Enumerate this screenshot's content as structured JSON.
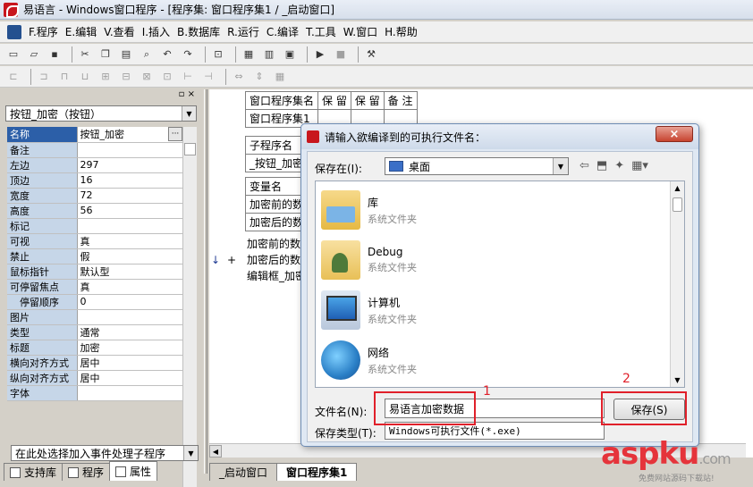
{
  "window": {
    "title": "易语言 - Windows窗口程序 - [程序集: 窗口程序集1 / _启动窗口]"
  },
  "menu": [
    "F.程序",
    "E.编辑",
    "V.查看",
    "I.插入",
    "B.数据库",
    "R.运行",
    "C.编译",
    "T.工具",
    "W.窗口",
    "H.帮助"
  ],
  "left_panel": {
    "object_combo": "按钮_加密（按钮）",
    "ellipsis": "···",
    "properties": [
      {
        "name": "名称",
        "value": "按钮_加密"
      },
      {
        "name": "备注",
        "value": ""
      },
      {
        "name": "左边",
        "value": "297"
      },
      {
        "name": "顶边",
        "value": "16"
      },
      {
        "name": "宽度",
        "value": "72"
      },
      {
        "name": "高度",
        "value": "56"
      },
      {
        "name": "标记",
        "value": ""
      },
      {
        "name": "可视",
        "value": "真"
      },
      {
        "name": "禁止",
        "value": "假"
      },
      {
        "name": "鼠标指针",
        "value": "默认型"
      },
      {
        "name": "可停留焦点",
        "value": "真"
      },
      {
        "name": "停留顺序",
        "value": "0"
      },
      {
        "name": "图片",
        "value": ""
      },
      {
        "name": "类型",
        "value": "通常"
      },
      {
        "name": "标题",
        "value": "加密"
      },
      {
        "name": "横向对齐方式",
        "value": "居中"
      },
      {
        "name": "纵向对齐方式",
        "value": "居中"
      },
      {
        "name": "字体",
        "value": ""
      }
    ],
    "event_combo": "在此处选择加入事件处理子程序",
    "tabs": [
      "支持库",
      "程序",
      "属性"
    ]
  },
  "code": {
    "table1": [
      "窗口程序集名",
      "保 留",
      "保 留",
      "备 注"
    ],
    "table1_row": "窗口程序集1",
    "table2_head": "子程序名",
    "table2_row": "_按钮_加密",
    "table3_head": "变量名",
    "table3_rows": [
      "加密前的数",
      "加密后的数"
    ],
    "lines": [
      "加密前的数",
      "加密后的数",
      "编辑框_加密"
    ],
    "tabs": [
      "_启动窗口",
      "窗口程序集1"
    ]
  },
  "dialog": {
    "title": "请输入欲编译到的可执行文件名：",
    "close": "×",
    "save_in_label": "保存在(I):",
    "save_in_value": "桌面",
    "items": [
      {
        "name": "库",
        "desc": "系统文件夹",
        "icon": "library-icon"
      },
      {
        "name": "Debug",
        "desc": "系统文件夹",
        "icon": "user-folder-icon"
      },
      {
        "name": "计算机",
        "desc": "系统文件夹",
        "icon": "computer-icon"
      },
      {
        "name": "网络",
        "desc": "系统文件夹",
        "icon": "network-icon"
      }
    ],
    "filename_label": "文件名(N):",
    "filename_value": "易语言加密数据",
    "filetype_label": "保存类型(T):",
    "filetype_value": "Windows可执行文件(*.exe)",
    "save_button": "保存(S)"
  },
  "annotations": [
    "1",
    "2"
  ],
  "watermark": {
    "main": "aspku",
    "dot": ".com",
    "sub": "免费网站源码下载站!"
  }
}
